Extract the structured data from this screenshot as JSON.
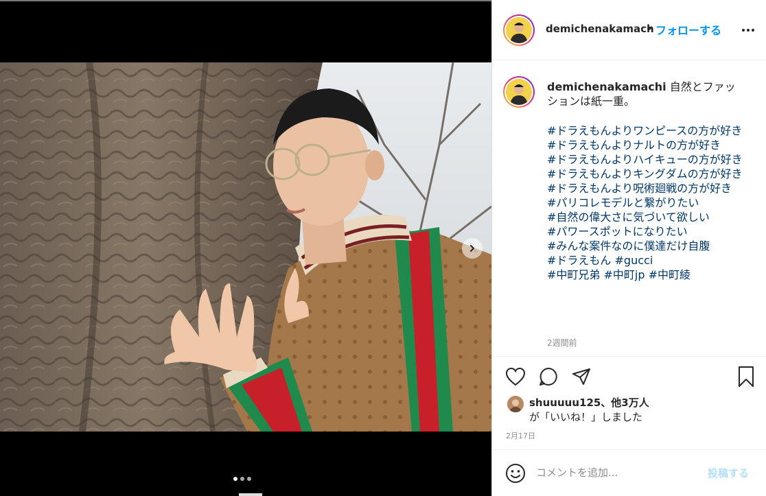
{
  "post": {
    "username": "demichenakamachi",
    "header_username": "demichenakamach",
    "header_separator": "•",
    "follow_label": "フォローする",
    "caption_text": "自然とファッションは紙一重。",
    "hashtags": [
      "#ドラえもんよりワンピースの方が好き",
      "#ドラえもんよりナルトの方が好き",
      "#ドラえもんよりハイキューの方が好き",
      "#ドラえもんよりキングダムの方が好き",
      "#ドラえもんより呪術廻戦の方が好き",
      "#パリコレモデルと繋がりたい",
      "#自然の偉大さに気づいて欲しい",
      "#パワースポットになりたい",
      "#みんな案件なのに僕達だけ自腹",
      "#ドラえもん",
      "#gucci",
      "#中町兄弟",
      "#中町jp",
      "#中町綾"
    ],
    "post_age": "2週間前",
    "likes_line1": "shuuuuu125、他3万人",
    "likes_line2": "が「いいね！」しました",
    "date": "2月17日"
  },
  "comment_box": {
    "placeholder": "コメントを追加...",
    "post_label": "投稿する"
  },
  "carousel": {
    "current": 1,
    "total": 3
  },
  "icons": [
    "more-icon",
    "heart-icon",
    "comment-icon",
    "share-icon",
    "bookmark-icon",
    "emoji-icon",
    "chevron-right-icon"
  ],
  "colors": {
    "link": "#0095f6",
    "hashtag": "#00376b",
    "muted": "#8e8e8e",
    "post_disabled": "#b2dffc"
  }
}
